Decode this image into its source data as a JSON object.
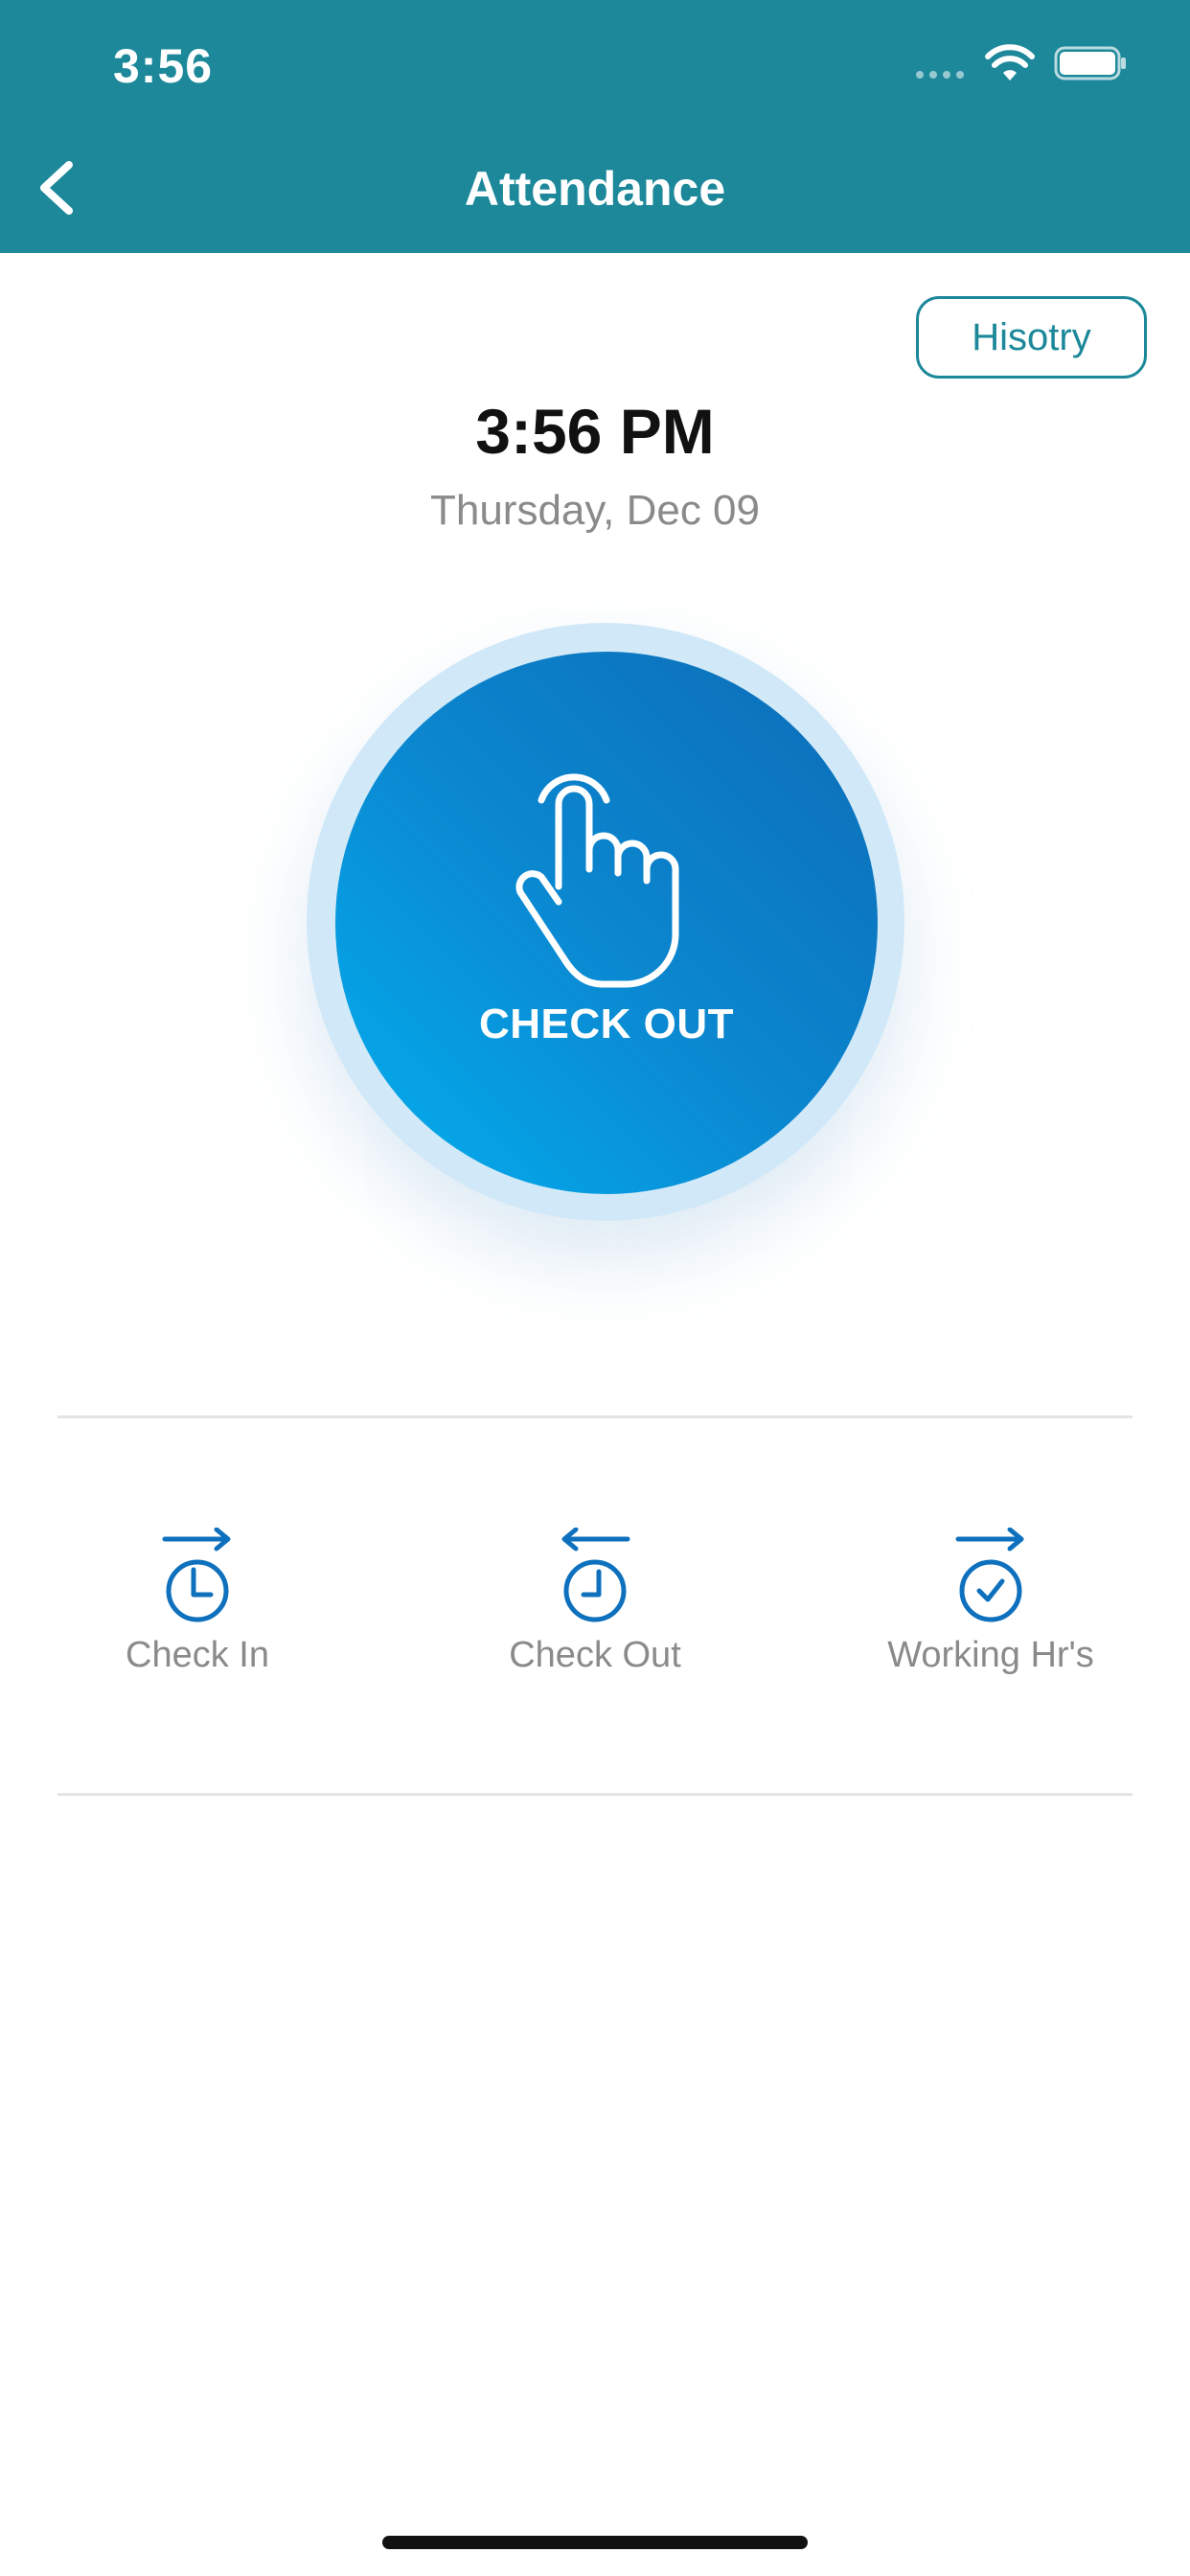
{
  "status_bar": {
    "time": "3:56"
  },
  "nav": {
    "title": "Attendance"
  },
  "history_button": {
    "label": "Hisotry"
  },
  "clock": {
    "time": "3:56 PM",
    "date": "Thursday, Dec 09"
  },
  "check_button": {
    "label": "CHECK OUT"
  },
  "stats": [
    {
      "label": "Check In",
      "icon": "check-in-clock-icon"
    },
    {
      "label": "Check Out",
      "icon": "check-out-clock-icon"
    },
    {
      "label": "Working Hr's",
      "icon": "working-hours-clock-icon"
    }
  ],
  "colors": {
    "header": "#1c889a",
    "accent_blue": "#0c6cb6",
    "button_light": "#03b0f0",
    "muted_text": "#8a8a8a"
  }
}
